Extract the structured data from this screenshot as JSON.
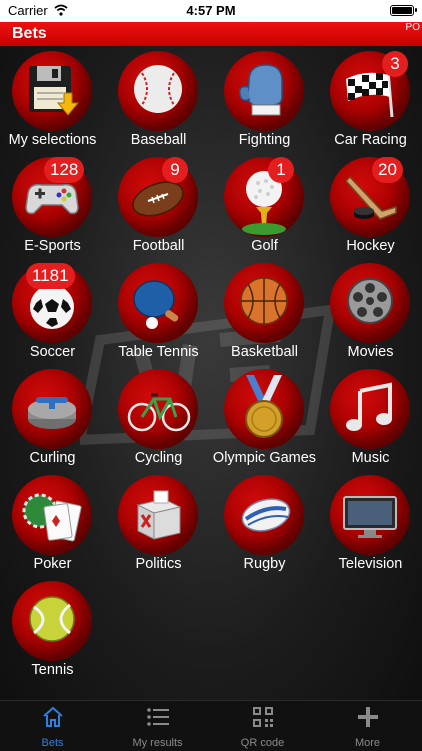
{
  "status_bar": {
    "carrier": "Carrier",
    "time": "4:57 PM"
  },
  "nav": {
    "title": "Bets",
    "corner_text": "PO"
  },
  "categories": [
    {
      "label": "My selections",
      "icon": "floppy-disk-icon"
    },
    {
      "label": "Baseball",
      "icon": "baseball-icon"
    },
    {
      "label": "Fighting",
      "icon": "boxing-glove-icon"
    },
    {
      "label": "Car Racing",
      "icon": "checkered-flag-icon",
      "badge": "3"
    },
    {
      "label": "E-Sports",
      "icon": "gamepad-icon",
      "badge": "128"
    },
    {
      "label": "Football",
      "icon": "american-football-icon",
      "badge": "9"
    },
    {
      "label": "Golf",
      "icon": "golf-ball-icon",
      "badge": "1"
    },
    {
      "label": "Hockey",
      "icon": "hockey-icon",
      "badge": "20"
    },
    {
      "label": "Soccer",
      "icon": "soccer-ball-icon",
      "badge": "1181"
    },
    {
      "label": "Table Tennis",
      "icon": "ping-pong-icon"
    },
    {
      "label": "Basketball",
      "icon": "basketball-icon"
    },
    {
      "label": "Movies",
      "icon": "film-reel-icon"
    },
    {
      "label": "Curling",
      "icon": "curling-stone-icon"
    },
    {
      "label": "Cycling",
      "icon": "bicycle-icon"
    },
    {
      "label": "Olympic Games",
      "icon": "medal-icon"
    },
    {
      "label": "Music",
      "icon": "music-note-icon"
    },
    {
      "label": "Poker",
      "icon": "playing-cards-icon"
    },
    {
      "label": "Politics",
      "icon": "ballot-box-icon"
    },
    {
      "label": "Rugby",
      "icon": "rugby-ball-icon"
    },
    {
      "label": "Television",
      "icon": "television-icon"
    },
    {
      "label": "Tennis",
      "icon": "tennis-ball-icon"
    }
  ],
  "tabs": [
    {
      "label": "Bets",
      "icon": "home-icon",
      "active": true
    },
    {
      "label": "My results",
      "icon": "list-icon"
    },
    {
      "label": "QR code",
      "icon": "qr-code-icon"
    },
    {
      "label": "More",
      "icon": "plus-icon"
    }
  ],
  "colors": {
    "accent_red": "#e41e1e",
    "tab_active": "#2d7fe0",
    "tab_inactive": "#8a8a8a"
  }
}
